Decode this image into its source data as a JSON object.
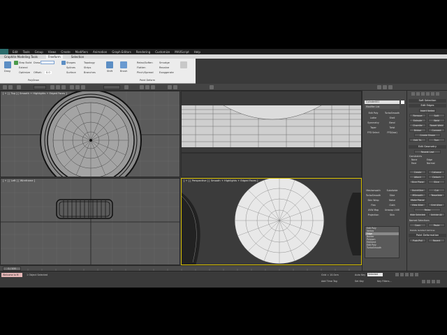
{
  "menu": {
    "items": [
      "Edit",
      "Tools",
      "Group",
      "Views",
      "Create",
      "Modifiers",
      "Animation",
      "Graph Editors",
      "Rendering",
      "Customize",
      "MAXScript",
      "Help"
    ]
  },
  "ribbon": {
    "title": "Graphite Modeling Tools",
    "tabs": [
      "Freeform",
      "Selection"
    ],
    "groups": {
      "drag": "Drag",
      "step_build": "Step Build",
      "extend": "Extend",
      "optimize": "Optimize",
      "draw_on": "Draw On:",
      "offset": "Offset:",
      "offset_value": "0.0",
      "shapes": "Shapes",
      "splines": "Splines",
      "surface": "Surface",
      "topology": "Topology",
      "strips": "Strips",
      "branches": "Branches",
      "shift": "Shift",
      "brush": "Brush",
      "relax_soften": "Relax/Soften",
      "flatten": "Flatten",
      "pinch_spread": "Pinch/Spread",
      "smudge": "Smudge",
      "revolve": "Revolve",
      "exaggerate": "Exaggerate",
      "polydraw": "PolyDraw",
      "paint_deform": "Paint Deform"
    }
  },
  "viewports": {
    "top_label": "[ + ] [ Top ] [ Smooth + Highlights + Edged Faces ]",
    "left_label": "[ + ] [ Left ] [ Wireframe ]",
    "persp_label": "[ + ] [ Perspective ] [ Smooth + Highlights + Edged Faces ]"
  },
  "mid_panel": {
    "object_name": "Cylinder001",
    "modifier_list": "Modifier List",
    "buttons": [
      [
        "Edit Poly",
        "TurboSmooth"
      ],
      [
        "Lathe",
        "Shell"
      ],
      [
        "Symmetry",
        "Bend"
      ],
      [
        "Taper",
        "Twist"
      ],
      [
        "FFD Select",
        "FFD(box)"
      ],
      [
        "Meshsmooth",
        "Subdivide"
      ],
      [
        "TurboSmooth",
        "Slice"
      ],
      [
        "Skin Wrap",
        "Noise"
      ],
      [
        "Flex",
        "Cloth"
      ],
      [
        "UVW Map",
        "Unwrap UVW"
      ],
      [
        "Projection",
        "Skin"
      ]
    ],
    "stack": [
      "Edit Poly",
      "Vertex",
      "Edge",
      "Border",
      "Polygon",
      "Element",
      "Edit Poly",
      "TurboSmooth"
    ],
    "selection_title": "Selection",
    "by_vertex": "By Vertex",
    "ignore_backfacing": "Ignore Backfacing",
    "shrink": "Shrink",
    "grow": "Grow",
    "ring": "Ring",
    "loop": "Loop",
    "preview": "Preview Selection"
  },
  "cmd_panel": {
    "soft_selection": "Soft Selection",
    "edit_edges": "Edit Edges",
    "insert_vertex": "Insert Vertex",
    "remove": "Remove",
    "split": "Split",
    "extrude": "Extrude",
    "weld": "Weld",
    "chamfer": "Chamfer",
    "target_weld": "Target Weld",
    "bridge": "Bridge",
    "connect": "Connect",
    "create_shape": "Create Shape",
    "edit_tri": "Edit Tri.",
    "turn": "Turn",
    "edit_geometry": "Edit Geometry",
    "repeat_last": "Repeat Last",
    "constraints": "Constraints",
    "none": "None",
    "edge": "Edge",
    "face": "Face",
    "normal": "Normal",
    "create": "Create",
    "collapse": "Collapse",
    "attach": "Attach",
    "detach": "Detach",
    "slice_plane": "Slice Plane",
    "slice": "Slice",
    "quickslice": "QuickSlice",
    "cut": "Cut",
    "msmooth": "MSmooth",
    "tessellate": "Tessellate",
    "make_planar": "Make Planar",
    "view_align": "View Align",
    "grid_align": "Grid Align",
    "relax": "Relax",
    "hide_selected": "Hide Selected",
    "unhide_all": "Unhide All",
    "named_selections": "Named Selections",
    "copy": "Copy",
    "paste": "Paste",
    "delete_isolated": "Delete Isolated Vertices",
    "paint_deformation": "Paint Deformation",
    "push_pull": "Push/Pull",
    "revert": "Revert"
  },
  "status": {
    "frame": "0 / 100",
    "objects_selected": "1 Object Selected",
    "grid": "Grid = 10.0cm",
    "add_time_tag": "Add Time Tag",
    "auto_key": "Auto Key",
    "set_key": "Set Key",
    "selected": "Selected",
    "key_filters": "Key Filters...",
    "welcome": "Welcome to M"
  },
  "colors": {
    "accent_yellow": "#f0d040",
    "accent_red": "#c83030"
  }
}
